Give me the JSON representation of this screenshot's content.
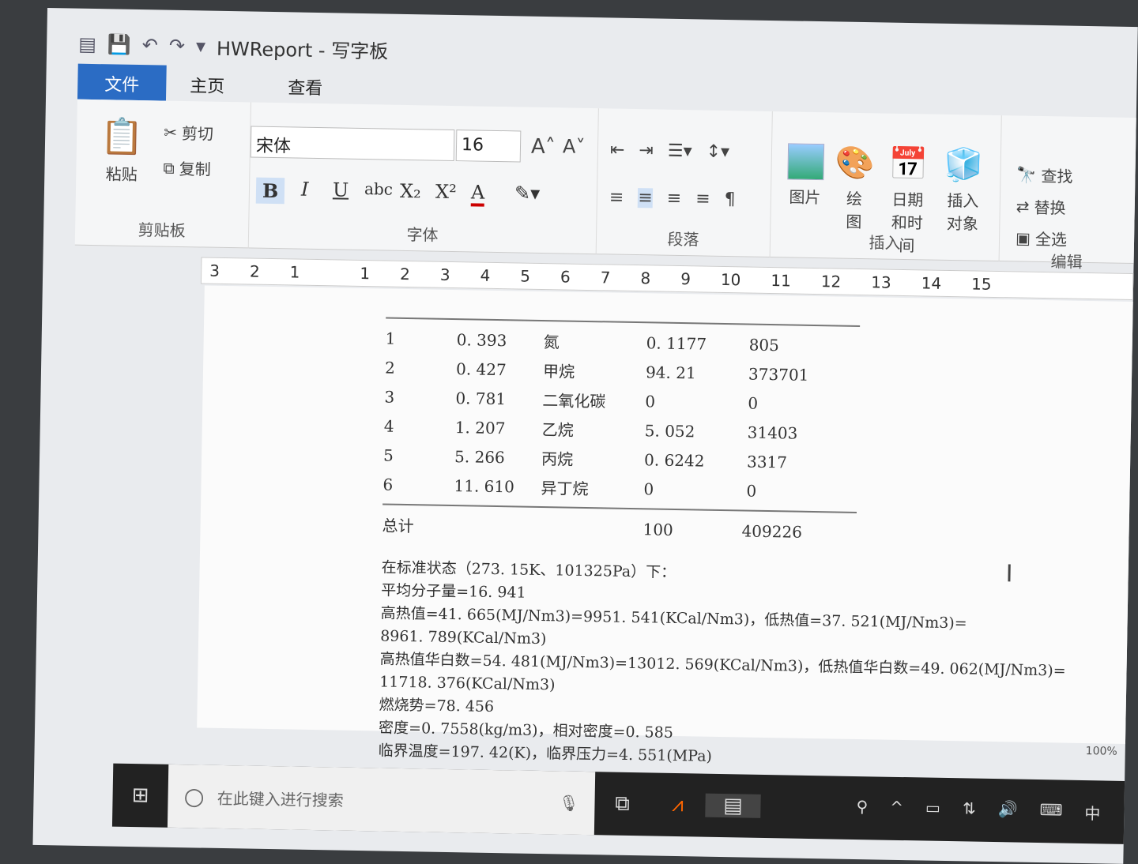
{
  "window": {
    "title": "HWReport - 写字板"
  },
  "tabs": [
    {
      "label": "文件"
    },
    {
      "label": "主页"
    },
    {
      "label": "查看"
    }
  ],
  "ribbon": {
    "clipboard": {
      "label": "剪贴板",
      "paste": "粘贴",
      "cut": "剪切",
      "copy": "复制"
    },
    "font": {
      "label": "字体",
      "family": "宋体",
      "size": "16",
      "bold": "B",
      "italic": "I",
      "underline": "U",
      "strike": "abc",
      "sub": "X₂",
      "sup": "X²",
      "color": "A",
      "grow": "A˄",
      "shrink": "A˅"
    },
    "paragraph": {
      "label": "段落"
    },
    "insert": {
      "label": "插入",
      "picture": "图片",
      "paint": "绘图",
      "datetime": "日期和时间",
      "object": "插入对象"
    },
    "edit": {
      "label": "编辑",
      "find": "查找",
      "replace": "替换",
      "selectall": "全选"
    }
  },
  "ruler": [
    "3",
    "2",
    "1",
    "",
    "1",
    "2",
    "3",
    "4",
    "5",
    "6",
    "7",
    "8",
    "9",
    "10",
    "11",
    "12",
    "13",
    "14",
    "15"
  ],
  "table": {
    "rows": [
      [
        "1",
        "0. 393",
        "氮",
        "0. 1177",
        "805"
      ],
      [
        "2",
        "0. 427",
        "甲烷",
        "94. 21",
        "373701"
      ],
      [
        "3",
        "0. 781",
        "二氧化碳",
        "0",
        "0"
      ],
      [
        "4",
        "1. 207",
        "乙烷",
        "5. 052",
        "31403"
      ],
      [
        "5",
        "5. 266",
        "丙烷",
        "0. 6242",
        "3317"
      ],
      [
        "6",
        "11. 610",
        "异丁烷",
        "0",
        "0"
      ]
    ],
    "total": [
      "总计",
      "100",
      "409226"
    ]
  },
  "paragraphs": [
    "在标准状态（273. 15K、101325Pa）下：",
    "平均分子量=16. 941",
    "高热值=41. 665(MJ/Nm3)=9951. 541(KCal/Nm3)，低热值=37. 521(MJ/Nm3)=",
    "8961. 789(KCal/Nm3)",
    "高热值华白数=54. 481(MJ/Nm3)=13012. 569(KCal/Nm3)，低热值华白数=49. 062(MJ/Nm3)=",
    "11718. 376(KCal/Nm3)",
    "燃烧势=78. 456",
    "密度=0. 7558(kg/m3)，相对密度=0. 585",
    "临界温度=197. 42(K)，临界压力=4. 551(MPa)"
  ],
  "status": {
    "zoom": "100%"
  },
  "taskbar": {
    "search_placeholder": "在此键入进行搜索",
    "ime": "中"
  }
}
